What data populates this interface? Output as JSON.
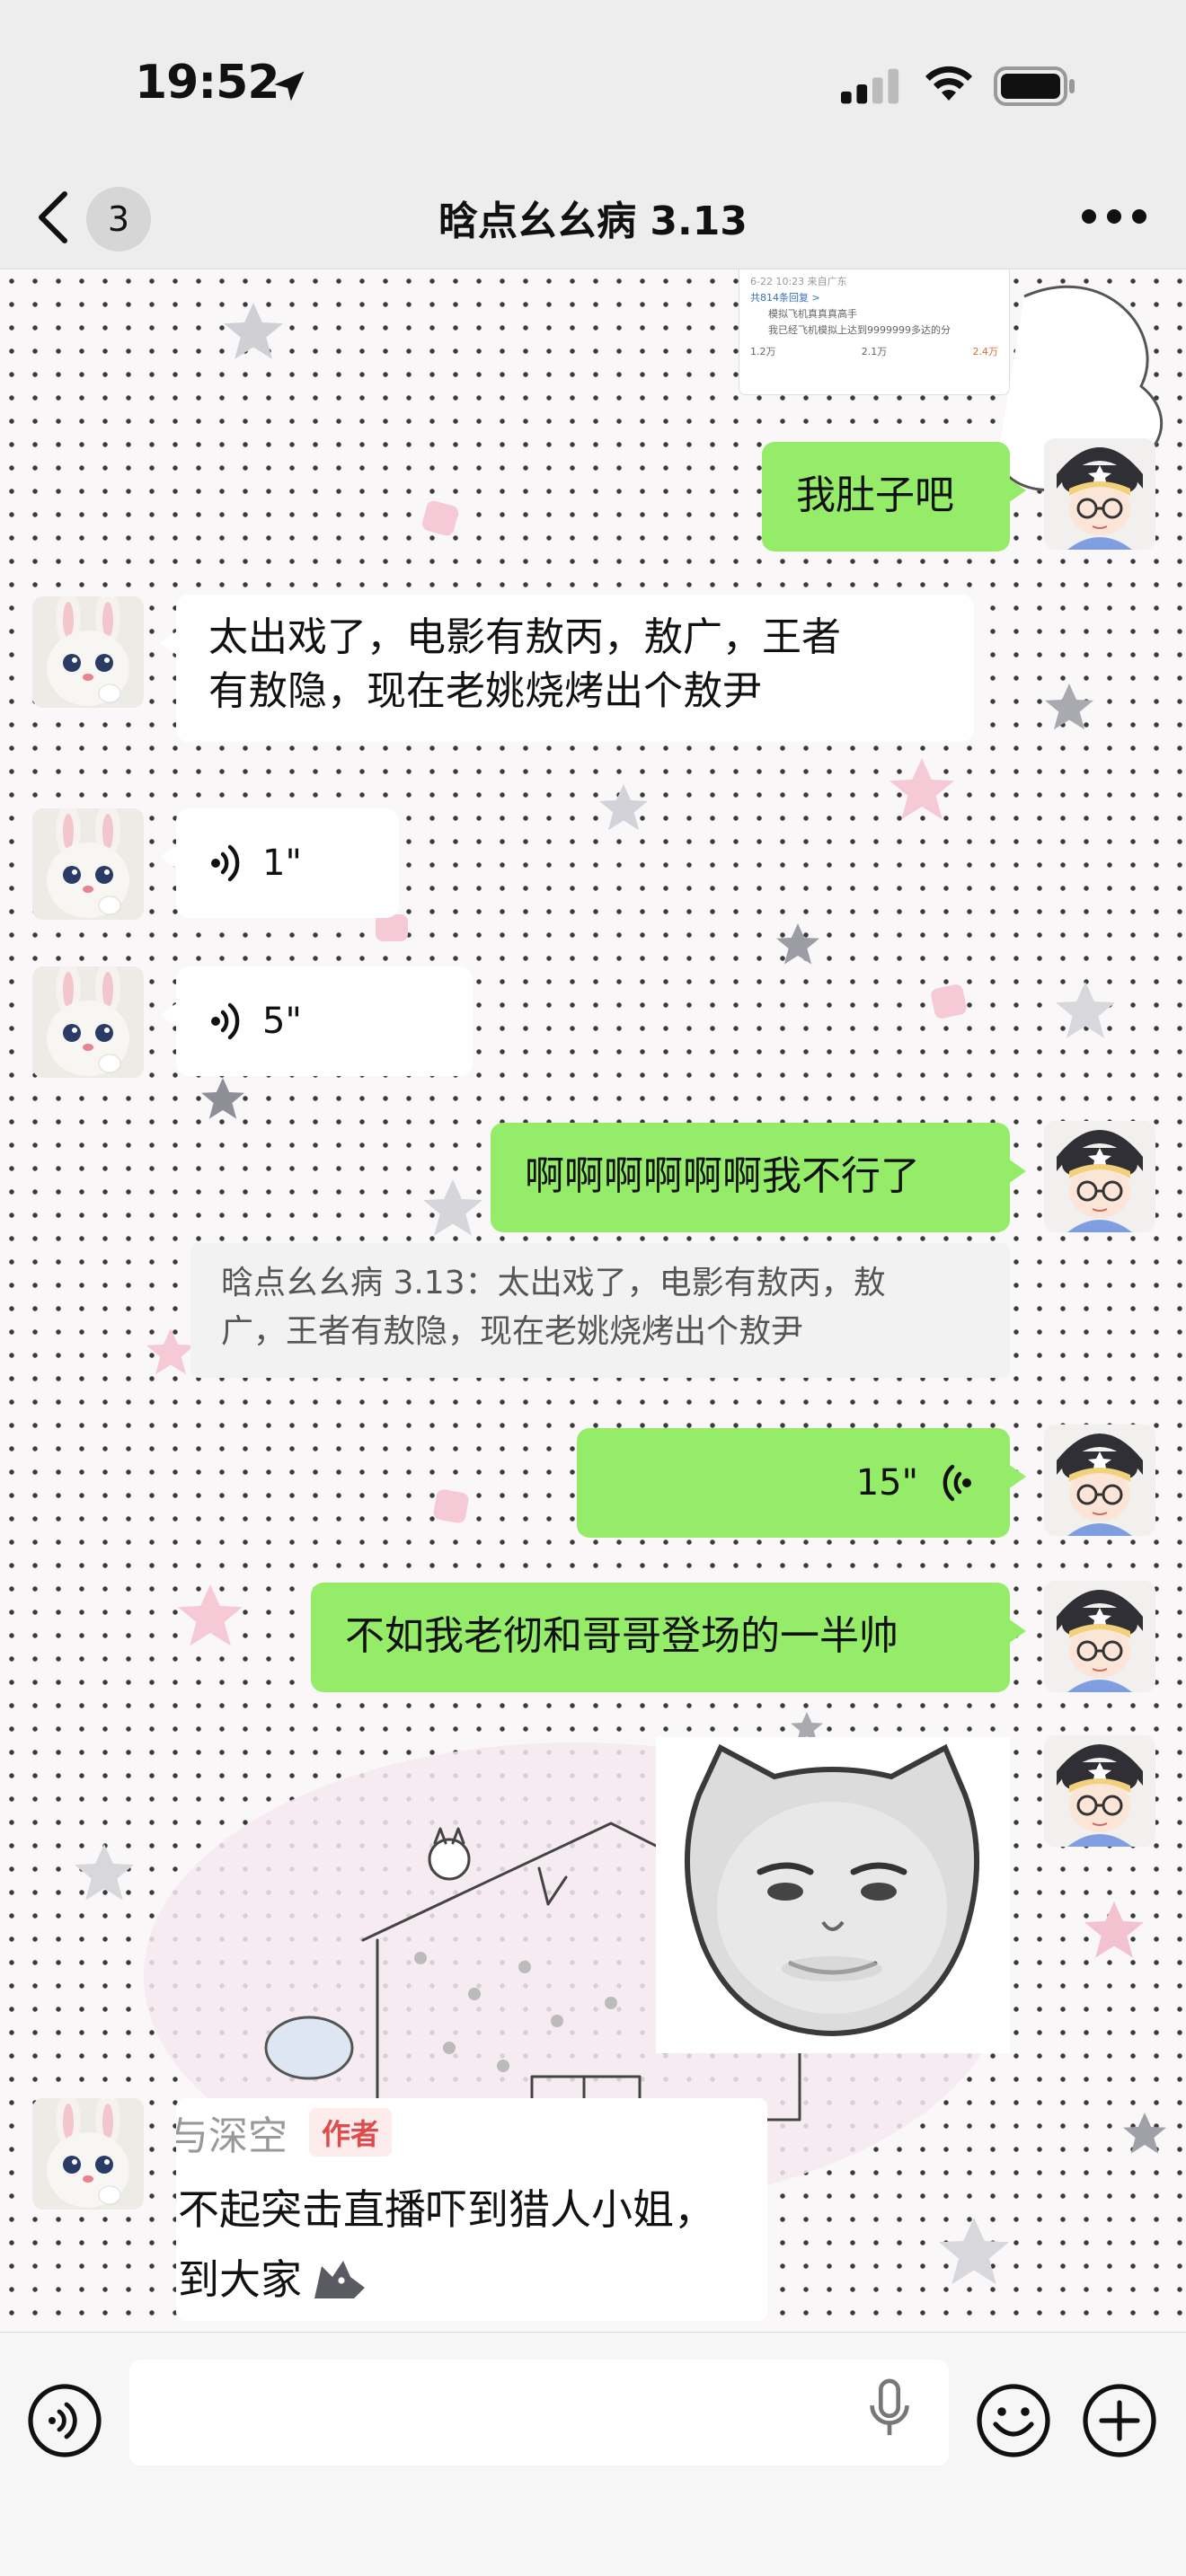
{
  "status_bar": {
    "time": "19:52"
  },
  "nav": {
    "unread_count": "3",
    "title": "晗点幺幺病 3.13"
  },
  "colors": {
    "bubble_green": "#95ec69",
    "bubble_white": "#ffffff",
    "author_tag": "#e04a4a"
  },
  "screenshot_card": {
    "line1": "6-22 10:23 来自广东",
    "line2": "共814条回复 >",
    "line3": "模拟飞机真真真高手",
    "line4": "我已经飞机模拟上达到9999999多达的分",
    "likes": "1.2万",
    "comments": "2.1万",
    "thumbs": "2.4万"
  },
  "messages": [
    {
      "side": "right",
      "type": "text",
      "text": "我肚子吧"
    },
    {
      "side": "left",
      "type": "text",
      "line1": "太出戏了，电影有敖丙，敖广，王者",
      "line2": "有敖隐，现在老姚烧烤出个敖尹"
    },
    {
      "side": "left",
      "type": "voice",
      "duration": "1\""
    },
    {
      "side": "left",
      "type": "voice",
      "duration": "5\""
    },
    {
      "side": "right",
      "type": "text",
      "text": "啊啊啊啊啊啊我不行了"
    },
    {
      "side": "right",
      "type": "quote",
      "line1": "晗点幺幺病 3.13：太出戏了，电影有敖丙，敖",
      "line2": "广，王者有敖隐，现在老姚烧烤出个敖尹"
    },
    {
      "side": "right",
      "type": "voice",
      "duration": "15\""
    },
    {
      "side": "right",
      "type": "text",
      "text": "不如我老彻和哥哥登场的一半帅"
    },
    {
      "side": "right",
      "type": "sticker",
      "icon": "cat-face-sticker"
    },
    {
      "side": "left",
      "type": "shared-card",
      "author": "与深空",
      "tag": "作者",
      "line1": "对不起突击直播吓到猎人小姐，",
      "line2": "见到大家"
    }
  ],
  "input_bar": {
    "placeholder": ""
  }
}
